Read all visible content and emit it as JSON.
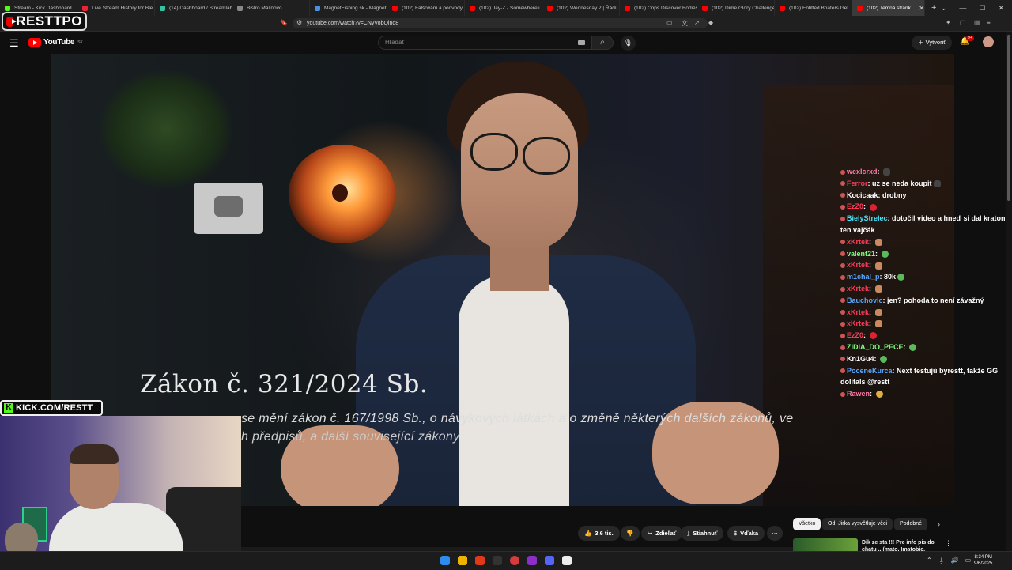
{
  "browser": {
    "tabs": [
      {
        "title": "Stream - Kick Dashboard",
        "color": "#53fc18"
      },
      {
        "title": "Live Stream History for Ble...",
        "color": "#e23"
      },
      {
        "title": "(14) Dashboard / Streamlab...",
        "color": "#31c3a2"
      },
      {
        "title": "Bistro Malinovo",
        "color": "#888888"
      },
      {
        "title": "MagnetFishing.sk - Magnet...",
        "color": "#4a90e2"
      },
      {
        "title": "(102) Falšování a podvody...",
        "color": "#ff0000"
      },
      {
        "title": "(102) Jay-Z - Somewhereli...",
        "color": "#ff0000"
      },
      {
        "title": "(102) Wednesday 2 | Řádí...",
        "color": "#ff0000"
      },
      {
        "title": "(102) Cops Discover Bodies...",
        "color": "#ff0000"
      },
      {
        "title": "(102) Dime Glory Challenge...",
        "color": "#ff0000"
      },
      {
        "title": "(102) Entitled Boaters Get ...",
        "color": "#ff0000"
      },
      {
        "title": "(102) Temná stránk...",
        "color": "#ff0000",
        "active": true
      }
    ],
    "new_tab": "+",
    "url": "youtube.com/watch?v=CNyVobQlno8"
  },
  "brand_overlay": "RESTTPO",
  "youtube": {
    "logo": "YouTube",
    "country": "SK",
    "search_placeholder": "Hľadať",
    "create_label": "Vytvoriť",
    "notif_badge": "9+"
  },
  "video": {
    "law_title": "Zákon č. 321/2024 Sb.",
    "law_sub1": "se mění zákon č. 167/1998 Sb., o návykových látkách a o změně některých dalších zákonů, ve",
    "law_sub2": "h předpisů, a další související zákony"
  },
  "chat": [
    {
      "user": "wexlcrxd",
      "color": "#ff7aa8",
      "msg": "",
      "emote": "dark"
    },
    {
      "user": "Ferror",
      "color": "#ff3b5b",
      "msg": "uz se neda koupit",
      "emote": "dark"
    },
    {
      "user": "Kocicaak",
      "color": "#ffffff",
      "msg": "drobny",
      "emote": ""
    },
    {
      "user": "EzZ0",
      "color": "#ff3b5b",
      "msg": "",
      "emote": "red"
    },
    {
      "user": "BielyStrelec",
      "color": "#43e6ff",
      "msg": "dotočil video a hneď si dal kraton ten vajčák",
      "emote": ""
    },
    {
      "user": "xKrtek",
      "color": "#ff3b5b",
      "msg": "",
      "emote": "hand"
    },
    {
      "user": "valent21",
      "color": "#7dff7d",
      "msg": "",
      "emote": "green"
    },
    {
      "user": "xKrtek",
      "color": "#ff3b5b",
      "msg": "",
      "emote": "hand"
    },
    {
      "user": "m1chal_p",
      "color": "#5aa8ff",
      "msg": "80k",
      "emote": "green"
    },
    {
      "user": "xKrtek",
      "color": "#ff3b5b",
      "msg": "",
      "emote": "hand"
    },
    {
      "user": "Bauchovic",
      "color": "#5aa8ff",
      "msg": "jen? pohoda to není závažný",
      "emote": ""
    },
    {
      "user": "xKrtek",
      "color": "#ff3b5b",
      "msg": "",
      "emote": "hand"
    },
    {
      "user": "xKrtek",
      "color": "#ff3b5b",
      "msg": "",
      "emote": "hand"
    },
    {
      "user": "EzZ0",
      "color": "#ff3b5b",
      "msg": "",
      "emote": "red"
    },
    {
      "user": "ZIDIA_DO_PECE",
      "color": "#7dff7d",
      "msg": "",
      "emote": "green"
    },
    {
      "user": "Kn1Gu4",
      "color": "#ffffff",
      "msg": "",
      "emote": "green"
    },
    {
      "user": "PoceneKurca",
      "color": "#5aa8ff",
      "msg": "Next testujú byrestt, takže GG dolitals @restt",
      "emote": ""
    },
    {
      "user": "Rawen",
      "color": "#ff7aa8",
      "msg": "",
      "emote": "yellow"
    }
  ],
  "webcam": {
    "kick_label": "KICK.COM/RESTT"
  },
  "actions": {
    "likes": "3,6 tis.",
    "share": "Zdieľať",
    "download": "Stiahnuť",
    "thanks": "Vďaka",
    "more": "⋯"
  },
  "chips": [
    "Všetko",
    "Od: Jirka vysvětluje věci",
    "Podobné"
  ],
  "recommended": {
    "title": "Dik ze sta !!! Pre info pis do chatu ...(mato, Imatobic, Idonat..."
  },
  "clock": {
    "time": "8:34 PM",
    "date": "9/6/2025"
  }
}
